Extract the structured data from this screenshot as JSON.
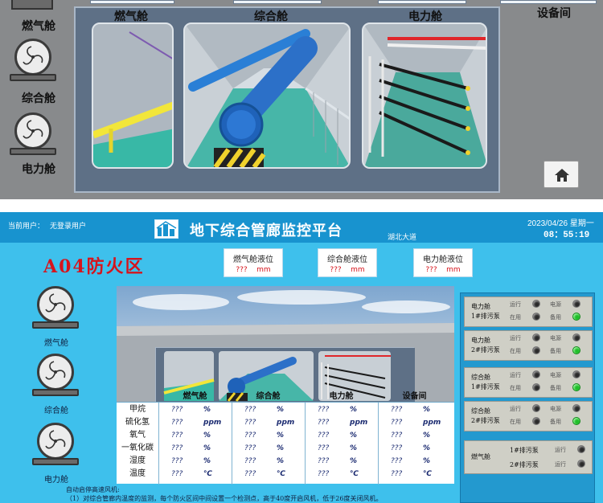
{
  "top": {
    "fans": [
      {
        "label": "燃气舱"
      },
      {
        "label": "综合舱"
      },
      {
        "label": "电力舱"
      }
    ],
    "tabs": [
      {
        "label": "燃气舱"
      },
      {
        "label": "综合舱"
      },
      {
        "label": "电力舱"
      },
      {
        "label": "设备间"
      }
    ]
  },
  "header": {
    "user_prefix": "当前用户：",
    "user_name": "无登录用户",
    "title": "地下综合管廊监控平台",
    "subtitle": "湖北大道",
    "date": "2023/04/26 星期一",
    "time": "08：55:19"
  },
  "zone_title": "A04防火区",
  "levels": [
    {
      "title": "燃气舱液位",
      "value": "???",
      "unit": "mm"
    },
    {
      "title": "综合舱液位",
      "value": "???",
      "unit": "mm"
    },
    {
      "title": "电力舱液位",
      "value": "???",
      "unit": "mm"
    }
  ],
  "fans": [
    {
      "label": "燃气舱"
    },
    {
      "label": "综合舱"
    },
    {
      "label": "电力舱"
    }
  ],
  "table": {
    "columns": [
      "燃气舱",
      "综合舱",
      "电力舱",
      "设备间"
    ],
    "rows": [
      {
        "label": "甲烷",
        "cells": [
          [
            "???",
            "%"
          ],
          [
            "???",
            "%"
          ],
          [
            "???",
            "%"
          ],
          [
            "???",
            "%"
          ]
        ]
      },
      {
        "label": "硫化氢",
        "cells": [
          [
            "???",
            "ppm"
          ],
          [
            "???",
            "ppm"
          ],
          [
            "???",
            "ppm"
          ],
          [
            "???",
            "ppm"
          ]
        ]
      },
      {
        "label": "氧气",
        "cells": [
          [
            "???",
            "%"
          ],
          [
            "???",
            "%"
          ],
          [
            "???",
            "%"
          ],
          [
            "???",
            "%"
          ]
        ]
      },
      {
        "label": "一氧化碳",
        "cells": [
          [
            "???",
            "%"
          ],
          [
            "???",
            "%"
          ],
          [
            "???",
            "%"
          ],
          [
            "???",
            "%"
          ]
        ]
      },
      {
        "label": "湿度",
        "cells": [
          [
            "???",
            "%"
          ],
          [
            "???",
            "%"
          ],
          [
            "???",
            "%"
          ],
          [
            "???",
            "%"
          ]
        ]
      },
      {
        "label": "温度",
        "cells": [
          [
            "???",
            "℃"
          ],
          [
            "???",
            "℃"
          ],
          [
            "???",
            "℃"
          ],
          [
            "???",
            "℃"
          ]
        ]
      }
    ]
  },
  "notes": [
    "自动启停高速风机:",
    "（1）对综合管廊内温度的监测，每个防火区间中间设置一个检测点，高于40度开启风机，低于26度关闭风机。"
  ],
  "pumps": [
    {
      "cabin": "电力舱",
      "pump": "1#排污泵",
      "status": [
        "运行",
        "在用",
        "电源",
        "备用"
      ],
      "leds": [
        false,
        false,
        false,
        true
      ]
    },
    {
      "cabin": "电力舱",
      "pump": "2#排污泵",
      "status": [
        "运行",
        "在用",
        "电源",
        "备用"
      ],
      "leds": [
        false,
        false,
        false,
        true
      ]
    },
    {
      "cabin": "综合舱",
      "pump": "1#排污泵",
      "status": [
        "运行",
        "在用",
        "电源",
        "备用"
      ],
      "leds": [
        false,
        false,
        false,
        true
      ]
    },
    {
      "cabin": "综合舱",
      "pump": "2#排污泵",
      "status": [
        "运行",
        "在用",
        "电源",
        "备用"
      ],
      "leds": [
        false,
        false,
        false,
        true
      ]
    }
  ],
  "gas_pumps": {
    "cabin": "燃气舱",
    "rows": [
      {
        "pump": "1#排污泵",
        "status": "运行",
        "led": false
      },
      {
        "pump": "2#排污泵",
        "status": "运行",
        "led": false
      }
    ]
  }
}
